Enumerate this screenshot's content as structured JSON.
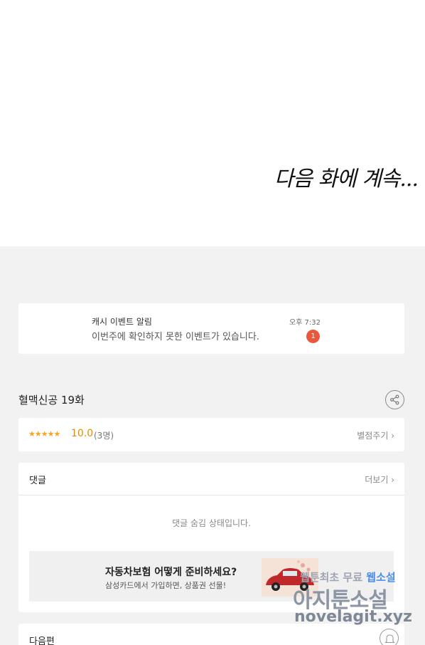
{
  "comic": {
    "to_be_continued": "다음 화에 계속..."
  },
  "notification": {
    "title": "캐시 이벤트 알림",
    "message": "이번주에 확인하지 못한 이벤트가 있습니다.",
    "time": "오후 7:32",
    "badge_count": "1"
  },
  "episode": {
    "title": "혈맥신공 19화"
  },
  "rating": {
    "stars": "★★★★★",
    "score": "10.0",
    "count": "(3명)",
    "rate_link": "별점주기 ›"
  },
  "comments": {
    "label": "댓글",
    "more": "더보기 ›",
    "hidden_message": "댓글 숨김 상태입니다."
  },
  "ad": {
    "title": "자동차보험 어떻게 준비하세요?",
    "subtitle": "삼성카드에서 가입하면, 상품권 선물!"
  },
  "next_episode": {
    "label": "다음편"
  },
  "watermark": {
    "line1": "웹툰최초 무료",
    "line1_highlight": "웹소설",
    "line2": "아지툰소설",
    "line3": "novelagit.xyz"
  },
  "icons": {
    "share": "share-icon",
    "bell": "bell-icon",
    "car": "car-image"
  }
}
